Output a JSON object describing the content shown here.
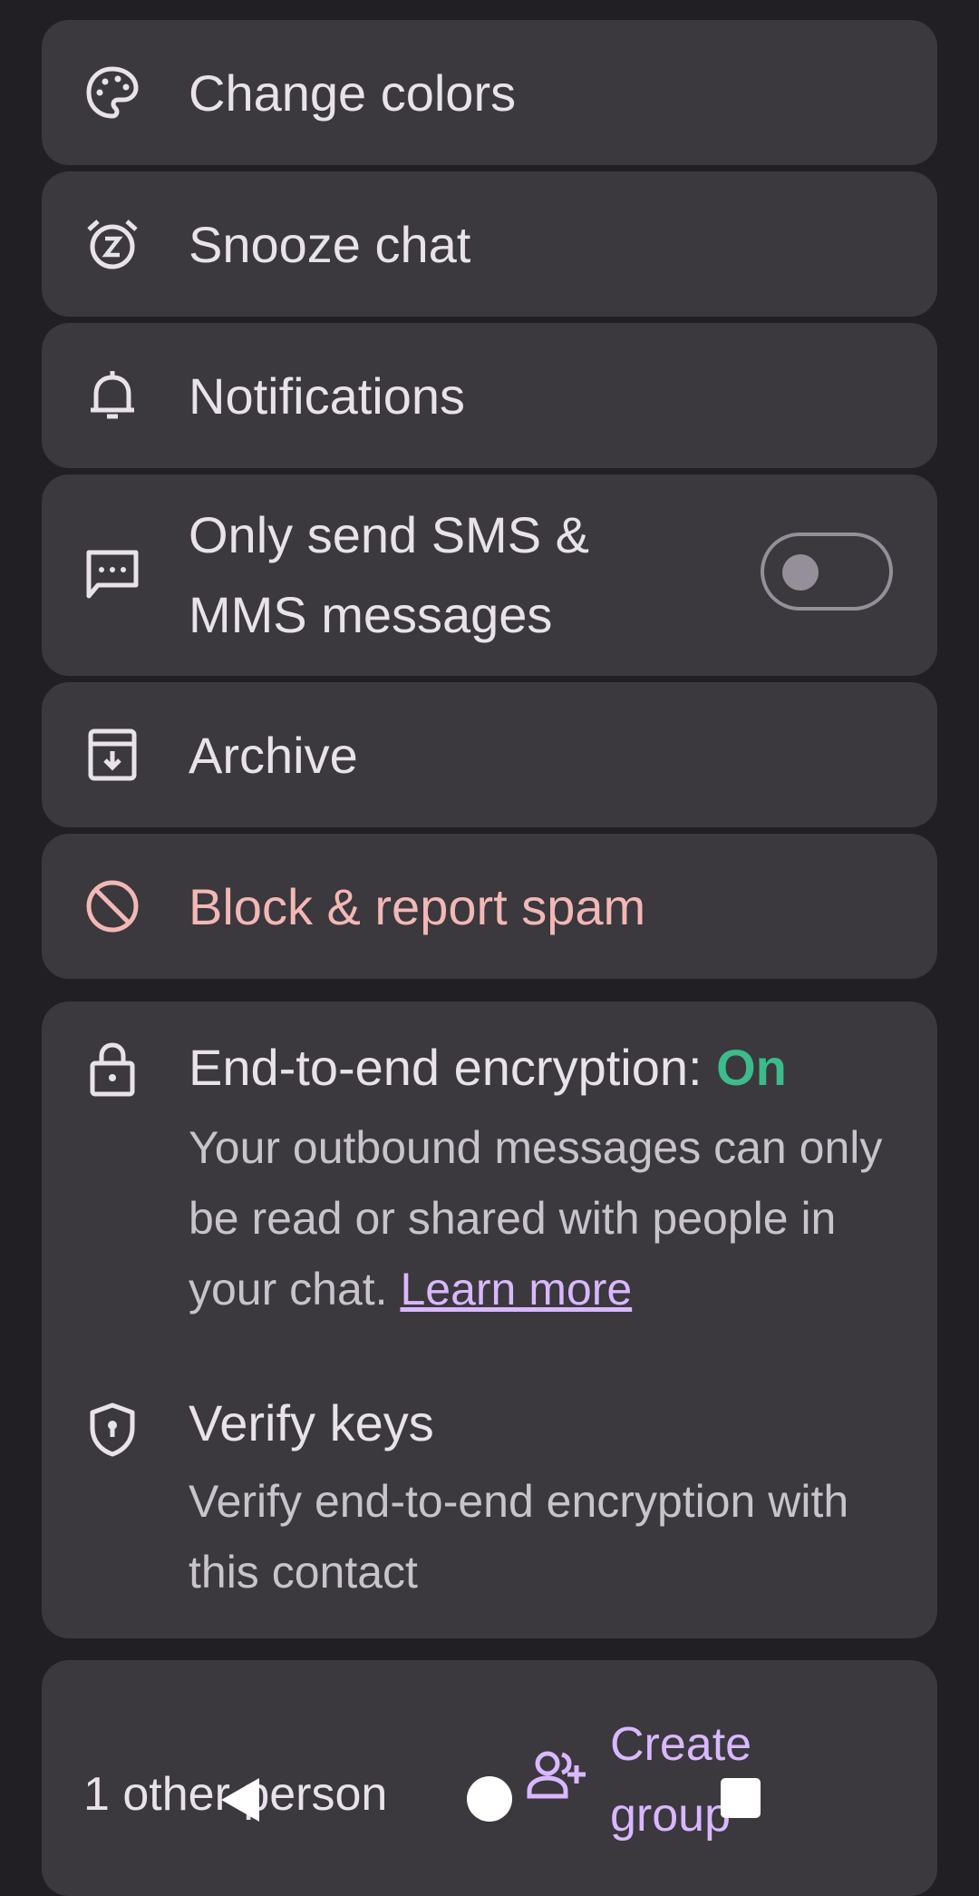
{
  "menu": {
    "change_colors": "Change colors",
    "snooze_chat": "Snooze chat",
    "notifications": "Notifications",
    "sms_only_line1": "Only send SMS &",
    "sms_only_line2": "MMS messages",
    "sms_only_enabled": false,
    "archive": "Archive",
    "block_report": "Block & report spam"
  },
  "encryption": {
    "title": "End-to-end encryption:",
    "status": "On",
    "description": "Your outbound messages can only be read or shared with people in your chat.",
    "learn_more": "Learn more",
    "verify_title": "Verify keys",
    "verify_description": "Verify end-to-end encryption with this contact"
  },
  "group": {
    "people_count": "1 other person",
    "create_line1": "Create",
    "create_line2": "group"
  },
  "colors": {
    "accent": "#d9b8ff",
    "danger": "#f2b8b5",
    "encryption_on": "#3cbb8b"
  }
}
